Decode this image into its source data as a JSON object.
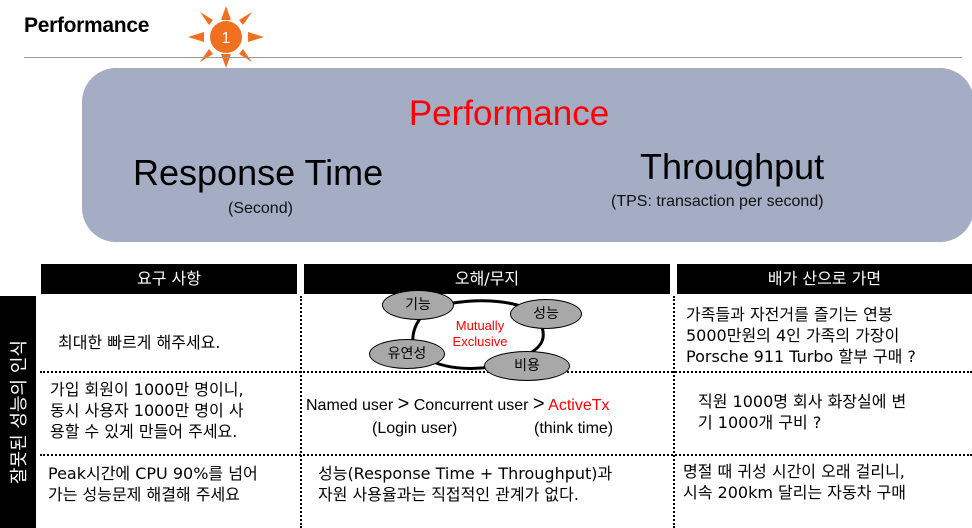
{
  "header": {
    "title": "Performance",
    "badge_number": "1"
  },
  "panel": {
    "title": "Performance",
    "response_time": "Response Time",
    "response_time_unit": "(Second)",
    "throughput": "Throughput",
    "throughput_unit": "(TPS: transaction per second)"
  },
  "table": {
    "side_label": "잘못된 성능의 인식",
    "headers": [
      "요구 사항",
      "오해/무지",
      "배가 산으로 가면"
    ],
    "row1": {
      "requirement": "최대한 빠르게 해주세요.",
      "diagram": {
        "ovals": [
          "기능",
          "성능",
          "유연성",
          "비용"
        ],
        "center_line1": "Mutually",
        "center_line2": "Exclusive"
      },
      "ship": [
        "가족들과 자전거를 즐기는 연봉",
        "5000만원의 4인 가족의 가장이",
        "Porsche 911 Turbo 할부 구매 ?"
      ]
    },
    "row2": {
      "requirement": [
        "가입 회원이 1000만 명이니,",
        "동시 사용자 1000만 명이 사",
        "용할 수 있게 만들어 주세요."
      ],
      "misc": {
        "named_user": "Named user",
        "gt": ">",
        "concurrent_user": "Concurrent user",
        "active_tx": "ActiveTx",
        "login_user": "(Login user)",
        "think_time": "(think time)"
      },
      "ship": [
        "직원 1000명 회사 화장실에 변",
        "기 1000개  구비 ?"
      ]
    },
    "row3": {
      "requirement": [
        "Peak시간에 CPU 90%를 넘어",
        "가는 성능문제 해결해 주세요"
      ],
      "misc": [
        "성능(Response Time + Throughput)과",
        "자원 사용율과는 직접적인 관계가 없다."
      ],
      "ship": [
        "명절 때 귀성 시간이 오래 걸리니,",
        "시속 200km 달리는 자동차 구매"
      ]
    }
  },
  "colors": {
    "panel": "#a4adc4",
    "accent_red": "#ff0000",
    "sun_orange": "#f07020"
  }
}
